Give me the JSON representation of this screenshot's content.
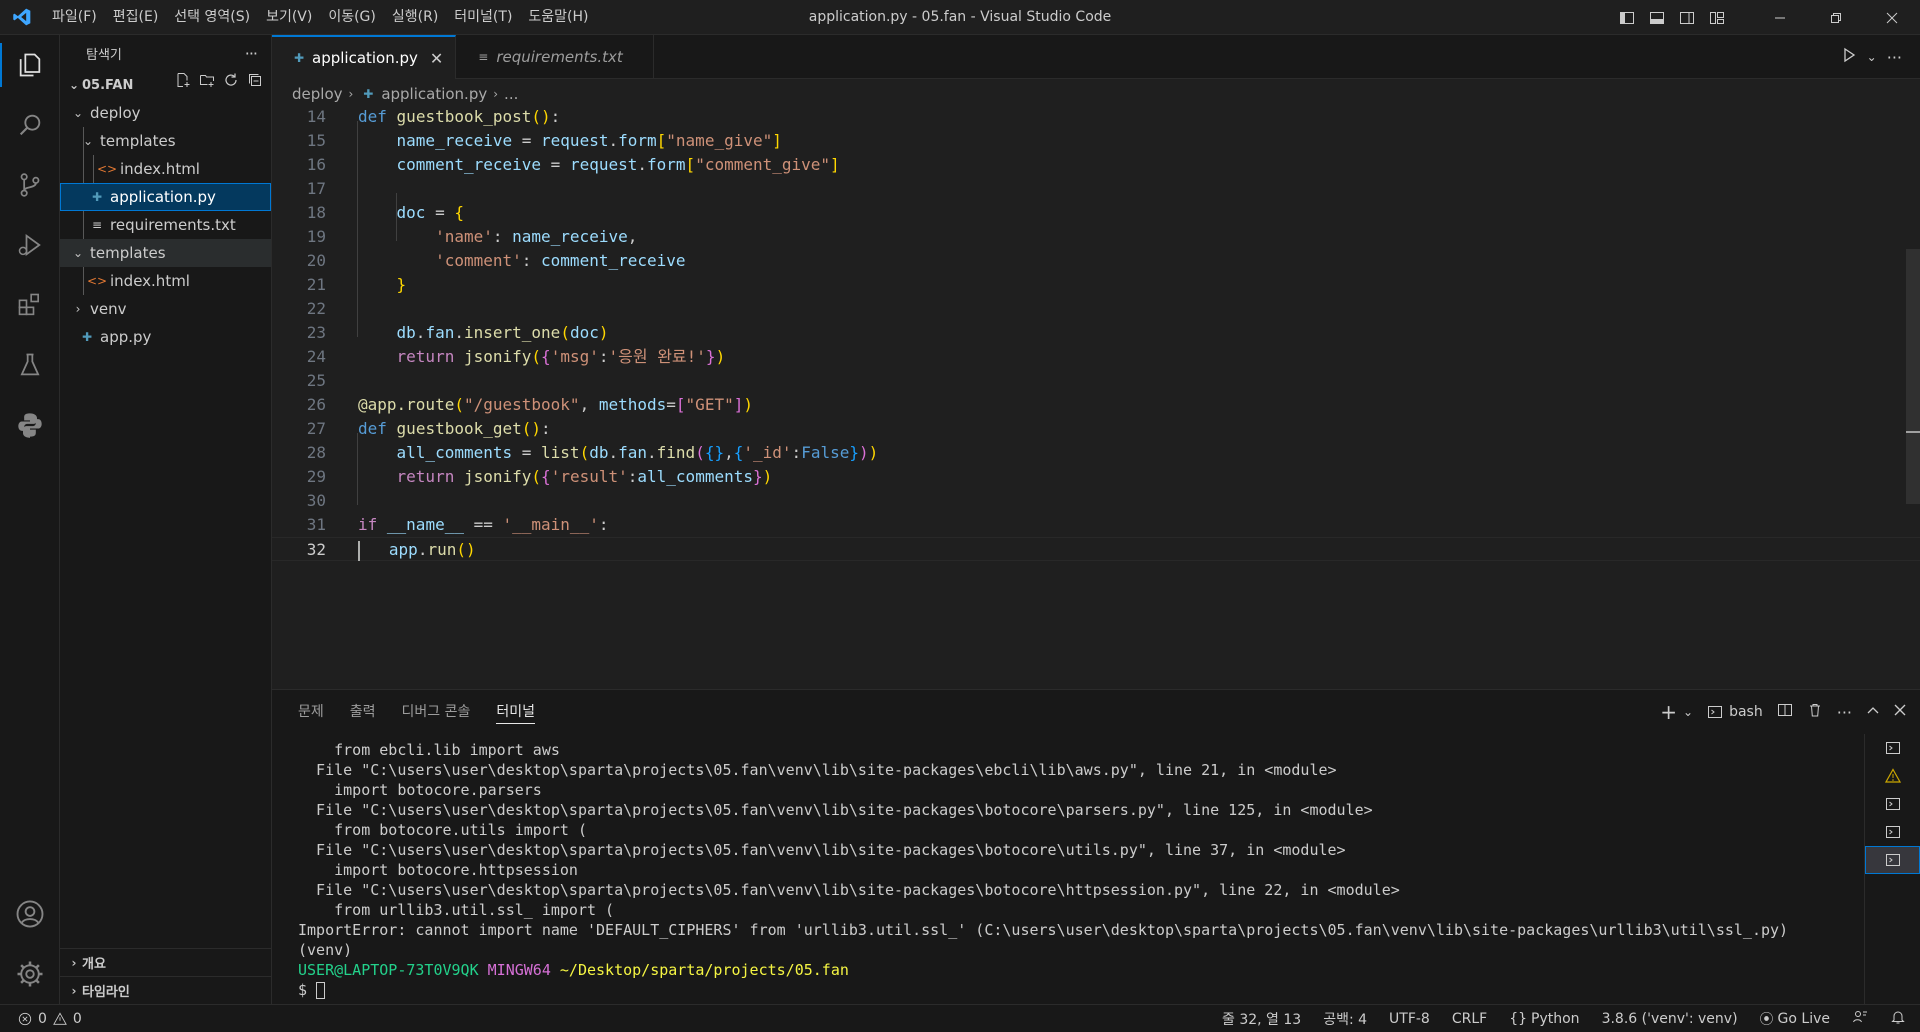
{
  "window": {
    "title": "application.py - 05.fan - Visual Studio Code",
    "menu": [
      "파일(F)",
      "편집(E)",
      "선택 영역(S)",
      "보기(V)",
      "이동(G)",
      "실행(R)",
      "터미널(T)",
      "도움말(H)"
    ]
  },
  "activity_bar": {
    "items": [
      "explorer",
      "search",
      "source-control",
      "run-and-debug",
      "extensions",
      "testing",
      "python"
    ],
    "bottom": [
      "accounts",
      "manage"
    ]
  },
  "sidebar": {
    "title": "탐색기",
    "more": "···",
    "root": "05.FAN",
    "tree": [
      {
        "label": "deploy",
        "type": "folder-open"
      },
      {
        "label": "templates",
        "type": "folder-open"
      },
      {
        "label": "index.html",
        "type": "html"
      },
      {
        "label": "application.py",
        "type": "python"
      },
      {
        "label": "requirements.txt",
        "type": "text"
      },
      {
        "label": "templates",
        "type": "folder-open"
      },
      {
        "label": "index.html",
        "type": "html"
      },
      {
        "label": "venv",
        "type": "folder-closed"
      },
      {
        "label": "app.py",
        "type": "python"
      }
    ],
    "bottom_sections": [
      "개요",
      "타임라인"
    ]
  },
  "tabs": [
    {
      "label": "application.py",
      "active": true,
      "close": "✕"
    },
    {
      "label": "requirements.txt",
      "active": false
    }
  ],
  "breadcrumb": {
    "items": [
      "deploy",
      "application.py",
      "..."
    ]
  },
  "editor": {
    "line_numbers": [
      "14",
      "15",
      "16",
      "17",
      "18",
      "19",
      "20",
      "21",
      "22",
      "23",
      "24",
      "25",
      "26",
      "27",
      "28",
      "29",
      "30",
      "31",
      "32"
    ],
    "current_line": "32"
  },
  "panel": {
    "tabs": [
      "문제",
      "출력",
      "디버그 콘솔",
      "터미널"
    ],
    "active_tab": "터미널",
    "shell_label": "bash",
    "terminal_lines": [
      "    from ebcli.lib import aws",
      "  File \"C:\\users\\user\\desktop\\sparta\\projects\\05.fan\\venv\\lib\\site-packages\\ebcli\\lib\\aws.py\", line 21, in <module>",
      "    import botocore.parsers",
      "  File \"C:\\users\\user\\desktop\\sparta\\projects\\05.fan\\venv\\lib\\site-packages\\botocore\\parsers.py\", line 125, in <module>",
      "    from botocore.utils import (",
      "  File \"C:\\users\\user\\desktop\\sparta\\projects\\05.fan\\venv\\lib\\site-packages\\botocore\\utils.py\", line 37, in <module>",
      "    import botocore.httpsession",
      "  File \"C:\\users\\user\\desktop\\sparta\\projects\\05.fan\\venv\\lib\\site-packages\\botocore\\httpsession.py\", line 22, in <module>",
      "    from urllib3.util.ssl_ import (",
      "ImportError: cannot import name 'DEFAULT_CIPHERS' from 'urllib3.util.ssl_' (C:\\users\\user\\desktop\\sparta\\projects\\05.fan\\venv\\lib\\site-packages\\urllib3\\util\\ssl_.py)",
      "(venv)"
    ],
    "prompt": {
      "user": "USER@LAPTOP-73T0V9QK",
      "system": "MINGW64",
      "path": "~/Desktop/sparta/projects/05.fan",
      "symbol": "$"
    }
  },
  "status_bar": {
    "errors": "0",
    "warnings": "0",
    "position": "줄 32, 열 13",
    "spaces": "공백: 4",
    "encoding": "UTF-8",
    "eol": "CRLF",
    "language": "Python",
    "interpreter": "3.8.6 ('venv': venv)",
    "go_live": "Go Live"
  },
  "colors": {
    "accent": "#0078d4",
    "keyword": "#569cd6",
    "function": "#dcdcaa",
    "variable": "#9cdcfe",
    "string": "#ce9178",
    "terminal_user": "#23d18b",
    "terminal_mingw": "#d670d6",
    "terminal_path": "#f5f543"
  }
}
